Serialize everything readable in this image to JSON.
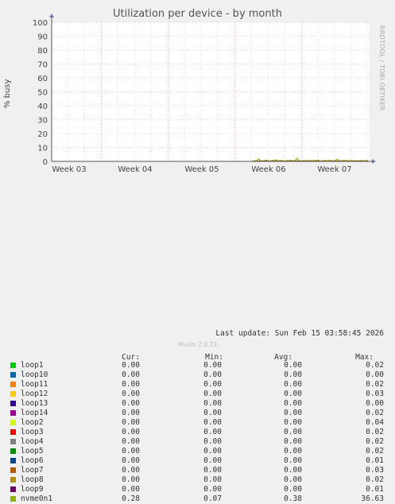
{
  "chart_data": {
    "type": "line",
    "title": "Utilization per device - by month",
    "ylabel": "% busy",
    "ylim": [
      0,
      100
    ],
    "yticks": [
      "0",
      "10",
      "20",
      "30",
      "40",
      "50",
      "60",
      "70",
      "80",
      "90",
      "100"
    ],
    "xticks": [
      "Week 03",
      "Week 04",
      "Week 05",
      "Week 06",
      "Week 07"
    ],
    "side_label": "RRDTOOL / TOBI OETIKER",
    "columns": [
      "Cur:",
      "Min:",
      "Avg:",
      "Max:"
    ],
    "series": [
      {
        "name": "loop1",
        "color": "#00cc00",
        "cur": "0.00",
        "min": "0.00",
        "avg": "0.00",
        "max": "0.02"
      },
      {
        "name": "loop10",
        "color": "#0066b3",
        "cur": "0.00",
        "min": "0.00",
        "avg": "0.00",
        "max": "0.00"
      },
      {
        "name": "loop11",
        "color": "#ff8000",
        "cur": "0.00",
        "min": "0.00",
        "avg": "0.00",
        "max": "0.02"
      },
      {
        "name": "loop12",
        "color": "#ffcc00",
        "cur": "0.00",
        "min": "0.00",
        "avg": "0.00",
        "max": "0.03"
      },
      {
        "name": "loop13",
        "color": "#330099",
        "cur": "0.00",
        "min": "0.00",
        "avg": "0.00",
        "max": "0.00"
      },
      {
        "name": "loop14",
        "color": "#990099",
        "cur": "0.00",
        "min": "0.00",
        "avg": "0.00",
        "max": "0.02"
      },
      {
        "name": "loop2",
        "color": "#ccff00",
        "cur": "0.00",
        "min": "0.00",
        "avg": "0.00",
        "max": "0.04"
      },
      {
        "name": "loop3",
        "color": "#ff0000",
        "cur": "0.00",
        "min": "0.00",
        "avg": "0.00",
        "max": "0.02"
      },
      {
        "name": "loop4",
        "color": "#808080",
        "cur": "0.00",
        "min": "0.00",
        "avg": "0.00",
        "max": "0.02"
      },
      {
        "name": "loop5",
        "color": "#008f00",
        "cur": "0.00",
        "min": "0.00",
        "avg": "0.00",
        "max": "0.02"
      },
      {
        "name": "loop6",
        "color": "#00487d",
        "cur": "0.00",
        "min": "0.00",
        "avg": "0.00",
        "max": "0.01"
      },
      {
        "name": "loop7",
        "color": "#b35a00",
        "cur": "0.00",
        "min": "0.00",
        "avg": "0.00",
        "max": "0.03"
      },
      {
        "name": "loop8",
        "color": "#b38f00",
        "cur": "0.00",
        "min": "0.00",
        "avg": "0.00",
        "max": "0.02"
      },
      {
        "name": "loop9",
        "color": "#6b006b",
        "cur": "0.00",
        "min": "0.00",
        "avg": "0.00",
        "max": "0.01"
      },
      {
        "name": "nvme0n1",
        "color": "#8fb300",
        "cur": "0.28",
        "min": "0.07",
        "avg": "0.38",
        "max": "36.63"
      }
    ],
    "nvme_values": [
      0.3,
      0.5,
      0.4,
      1.8,
      0.6,
      0.4,
      0.5,
      0.9,
      0.4,
      0.3,
      0.6,
      0.5,
      1.2,
      0.4,
      0.5,
      0.7,
      0.4,
      0.3,
      0.6,
      0.5,
      0.8,
      0.4,
      0.5,
      2.1,
      0.6,
      0.4,
      0.5,
      0.6,
      0.4,
      0.7,
      0.5,
      0.4,
      0.6,
      0.5,
      0.9,
      0.4,
      0.3,
      0.5,
      0.6,
      0.4,
      0.8,
      0.5,
      0.4,
      0.6,
      1.5,
      0.5,
      0.4,
      0.6,
      0.5,
      0.7,
      0.4,
      0.5,
      0.6,
      0.4,
      0.5,
      0.3,
      0.6,
      0.5,
      0.4,
      0.6,
      0.5
    ],
    "last_update": "Last update: Sun Feb 15 03:58:45 2026",
    "footer": "Munin 2.0.73"
  }
}
